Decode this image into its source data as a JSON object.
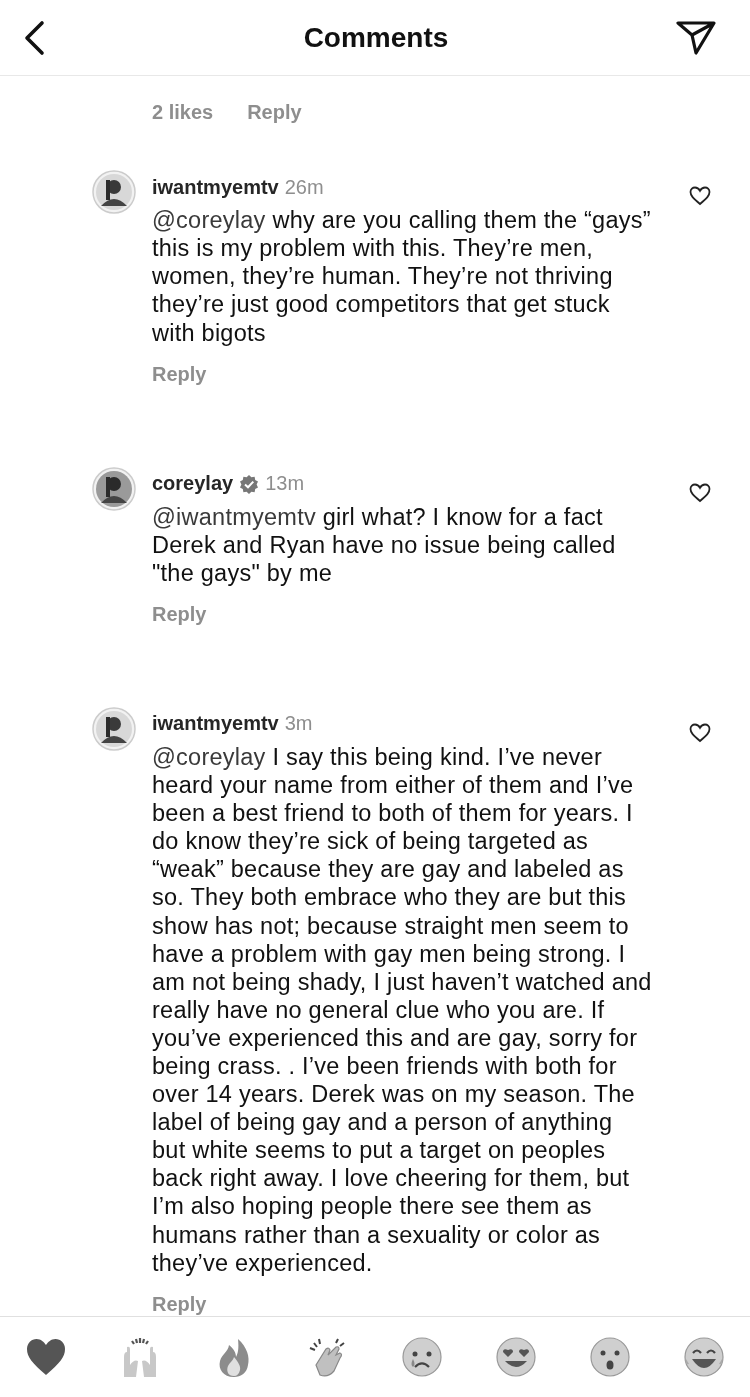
{
  "header": {
    "title": "Comments"
  },
  "previous_comment": {
    "likes": "2 likes",
    "reply": "Reply"
  },
  "comments": [
    {
      "username": "iwantmyemtv",
      "verified": false,
      "time": "26m",
      "mention": "@coreylay",
      "text": "why are you calling them the “gays” this is my problem with this. They’re men, women, they’re human. They’re not thriving they’re just good competitors that get stuck with bigots",
      "reply": "Reply",
      "liked": false
    },
    {
      "username": "coreylay",
      "verified": true,
      "time": "13m",
      "mention": "@iwantmyemtv",
      "text": "girl what? I know for a fact Derek and Ryan have no issue being called \"the gays\" by me",
      "reply": "Reply",
      "liked": false
    },
    {
      "username": "iwantmyemtv",
      "verified": false,
      "time": "3m",
      "mention": "@coreylay",
      "text": "I say this being kind. I’ve never heard your name from either of them and I’ve been a best friend to both of them for years. I do know they’re sick of being targeted as “weak” because they are gay and labeled as so. They both embrace who they are but this show has not; because straight men seem to have a problem with gay men being strong. I am not being shady, I just haven’t watched and really have no general clue who you are. If you’ve experienced this and are gay, sorry for being crass. . I’ve been friends with both for over 14 years. Derek was on my season. The label of being gay and a person of anything but white seems to put a target on peoples back right away. I love cheering for them, but I’m also hoping people there see them as humans rather than a sexuality or color as they’ve experienced.",
      "reply": "Reply",
      "liked": false
    }
  ],
  "reactions": [
    {
      "kind": "heart"
    },
    {
      "kind": "raised-hands"
    },
    {
      "kind": "fire"
    },
    {
      "kind": "clap"
    },
    {
      "kind": "crying"
    },
    {
      "kind": "heart-eyes"
    },
    {
      "kind": "surprised"
    },
    {
      "kind": "laughing"
    }
  ]
}
